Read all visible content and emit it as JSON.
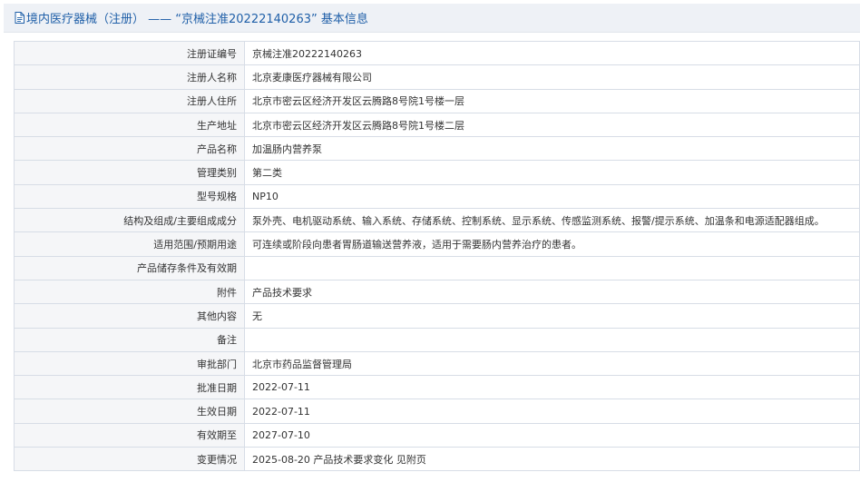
{
  "header": {
    "title": "境内医疗器械（注册） —— “京械注准20222140263” 基本信息",
    "icon": "document-icon"
  },
  "rows": [
    {
      "label": "注册证编号",
      "value": "京械注准20222140263"
    },
    {
      "label": "注册人名称",
      "value": "北京麦康医疗器械有限公司"
    },
    {
      "label": "注册人住所",
      "value": "北京市密云区经济开发区云腾路8号院1号楼一层"
    },
    {
      "label": "生产地址",
      "value": "北京市密云区经济开发区云腾路8号院1号楼二层"
    },
    {
      "label": "产品名称",
      "value": "加温肠内营养泵"
    },
    {
      "label": "管理类别",
      "value": "第二类"
    },
    {
      "label": "型号规格",
      "value": "NP10"
    },
    {
      "label": "结构及组成/主要组成成分",
      "value": "泵外壳、电机驱动系统、输入系统、存储系统、控制系统、显示系统、传感监测系统、报警/提示系统、加温条和电源适配器组成。"
    },
    {
      "label": "适用范围/预期用途",
      "value": "可连续或阶段向患者胃肠道输送营养液，适用于需要肠内营养治疗的患者。"
    },
    {
      "label": "产品储存条件及有效期",
      "value": ""
    },
    {
      "label": "附件",
      "value": "产品技术要求"
    },
    {
      "label": "其他内容",
      "value": "无"
    },
    {
      "label": "备注",
      "value": ""
    },
    {
      "label": "审批部门",
      "value": "北京市药品监督管理局"
    },
    {
      "label": "批准日期",
      "value": "2022-07-11"
    },
    {
      "label": "生效日期",
      "value": "2022-07-11"
    },
    {
      "label": "有效期至",
      "value": "2027-07-10"
    },
    {
      "label": "变更情况",
      "value": "2025-08-20 产品技术要求变化 见附页"
    }
  ],
  "colors": {
    "title_text": "#1f5fa8",
    "title_background": "#eef1f6",
    "label_background": "#f5f6f8",
    "border": "#d7dde6"
  }
}
